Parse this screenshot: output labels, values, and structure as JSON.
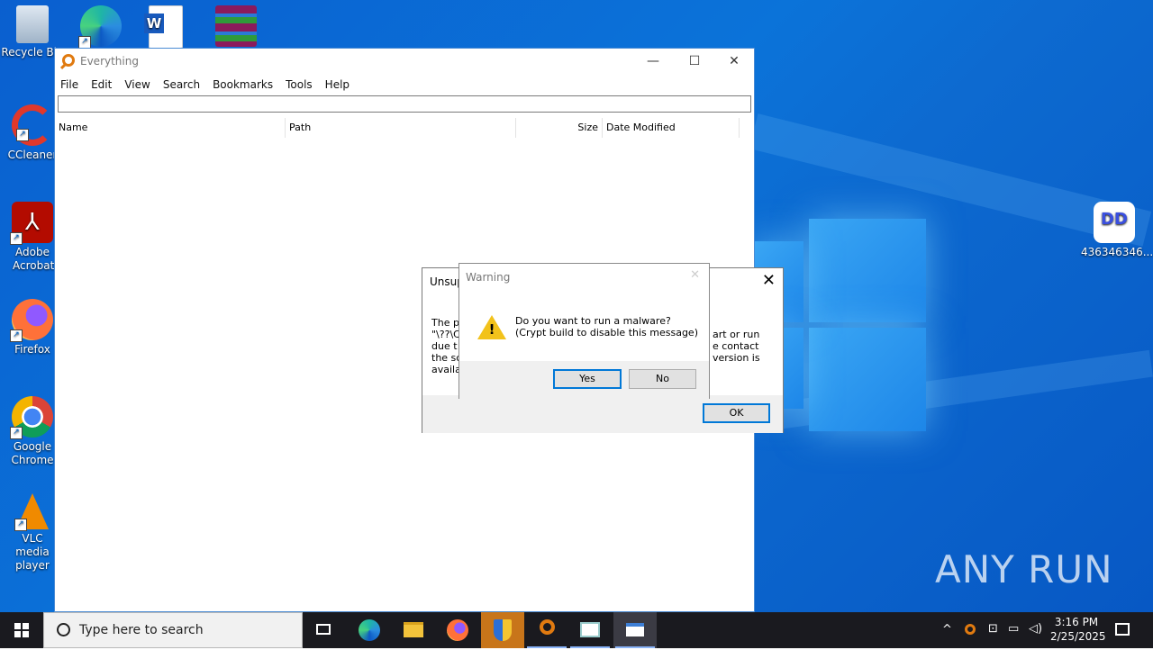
{
  "desktop": {
    "icons": [
      {
        "label": "Recycle Bin"
      },
      {
        "label": ""
      },
      {
        "label": ""
      },
      {
        "label": ""
      },
      {
        "label": "CCleaner"
      },
      {
        "label": "Adobe Acrobat"
      },
      {
        "label": "Firefox"
      },
      {
        "label": "Google Chrome"
      },
      {
        "label": "VLC media player"
      },
      {
        "label": "436346346..."
      }
    ],
    "watermark": "ANY RUN"
  },
  "window": {
    "title": "Everything",
    "menu": [
      "File",
      "Edit",
      "View",
      "Search",
      "Bookmarks",
      "Tools",
      "Help"
    ],
    "search_value": "",
    "columns": [
      "Name",
      "Path",
      "Size",
      "Date Modified"
    ]
  },
  "unsupported_dialog": {
    "title": "Unsup",
    "message_lines": [
      "The p",
      "\"\\??\\C",
      "due t",
      "the sc",
      "availa"
    ],
    "message_right": [
      "art or run",
      "e contact",
      "version is"
    ],
    "ok_label": "OK"
  },
  "warning_dialog": {
    "title": "Warning",
    "line1": "Do you want to run a malware?",
    "line2": "(Crypt build to disable this message)",
    "yes_label": "Yes",
    "no_label": "No"
  },
  "taskbar": {
    "search_placeholder": "Type here to search",
    "time": "3:16 PM",
    "date": "2/25/2025"
  }
}
